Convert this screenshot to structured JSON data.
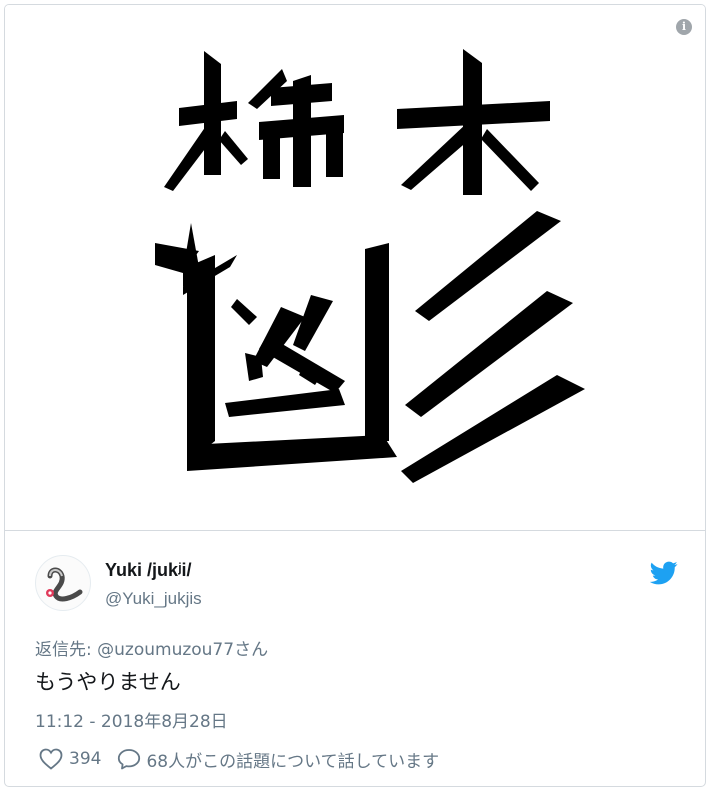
{
  "media": {
    "image_subject": "kanji-character-utsu-image",
    "info_icon": "info-icon",
    "info_glyph": "i"
  },
  "author": {
    "avatar_icon": "eel-avatar-icon",
    "display_name": "Yuki /jukʲi/",
    "handle": "@Yuki_jukjis"
  },
  "platform_icon": "twitter-bird-icon",
  "brand_color": "#1da1f2",
  "tweet": {
    "reply_to": "返信先: @uzoumuzou77さん",
    "text": "もうやりません",
    "timestamp": "11:12 - 2018年8月28日"
  },
  "actions": {
    "like_icon": "heart-icon",
    "like_count": "394",
    "conversation_icon": "speech-bubble-icon",
    "conversation_text": "68人がこの話題について話しています"
  }
}
